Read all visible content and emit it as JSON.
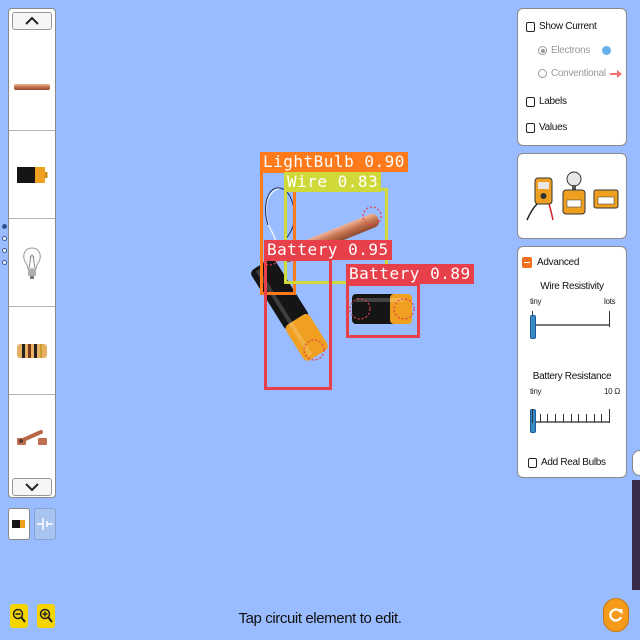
{
  "toolbox": {
    "scroll_up_icon": "chevron-up-icon",
    "scroll_down_icon": "chevron-down-icon",
    "items": [
      "wire-icon",
      "battery-icon",
      "lightbulb-icon",
      "resistor-icon",
      "switch-icon"
    ],
    "modes": [
      "battery-mode-icon",
      "schematic-mode-icon"
    ]
  },
  "view_options": {
    "show_current": "Show Current",
    "electrons": "Electrons",
    "conventional": "Conventional",
    "labels": "Labels",
    "values": "Values"
  },
  "tools": [
    "voltmeter-icon",
    "ammeter-icon",
    "stopwatch-icon"
  ],
  "advanced": {
    "title": "Advanced",
    "wire_resistivity": "Wire Resistivity",
    "wire_min": "tiny",
    "wire_max": "lots",
    "wire_level": 0.0,
    "battery_resistance": "Battery Resistance",
    "battery_min": "tiny",
    "battery_max": "10 Ω",
    "battery_level": 0.0,
    "add_real_bulbs": "Add Real Bulbs"
  },
  "detections": [
    {
      "label": "LightBulb 0.90",
      "color": "#ff7a1a"
    },
    {
      "label": "Wire 0.83",
      "color": "#cfd93a"
    },
    {
      "label": "Battery 0.95",
      "color": "#e8404a"
    },
    {
      "label": "Battery 0.89",
      "color": "#e8404a"
    }
  ],
  "status": {
    "hint": "Tap circuit element to edit."
  },
  "bottom_bar": {
    "zoom_out_icon": "zoom-out-icon",
    "zoom_in_icon": "zoom-in-icon",
    "reset_icon": "reset-icon"
  },
  "colors": {
    "background": "#99bbff",
    "panel": "#ffffff",
    "zoom": "#f5d400",
    "reset": "#f59a1a"
  }
}
